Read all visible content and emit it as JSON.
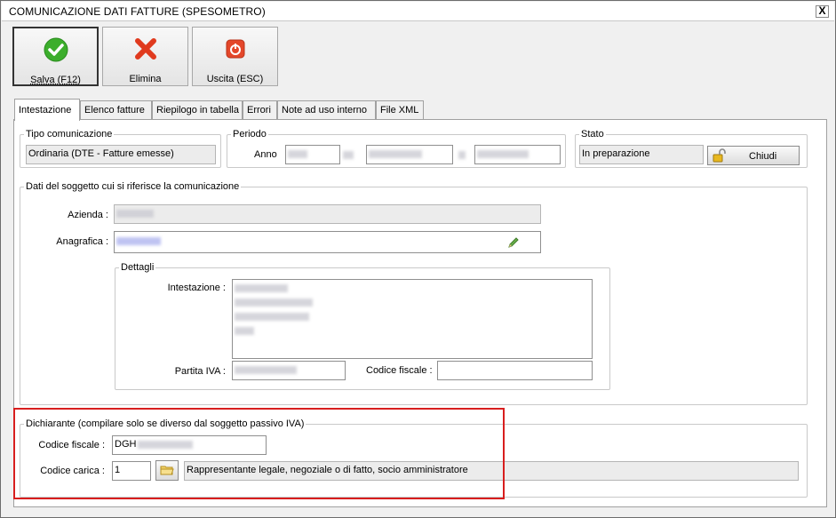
{
  "window": {
    "title": "COMUNICAZIONE DATI FATTURE (SPESOMETRO)",
    "close_label": "X"
  },
  "toolbar": {
    "save_label": "Salva (F12)",
    "delete_label": "Elimina",
    "exit_label": "Uscita (ESC)"
  },
  "tabs": [
    {
      "label": "Intestazione"
    },
    {
      "label": "Elenco fatture"
    },
    {
      "label": "Riepilogo in tabella"
    },
    {
      "label": "Errori"
    },
    {
      "label": "Note ad uso interno"
    },
    {
      "label": "File XML"
    }
  ],
  "tipo": {
    "legend": "Tipo comunicazione",
    "value": "Ordinaria (DTE - Fatture emesse)"
  },
  "periodo": {
    "legend": "Periodo",
    "anno_label": "Anno"
  },
  "stato": {
    "legend": "Stato",
    "value": "In preparazione",
    "chiudi_label": "Chiudi"
  },
  "soggetto": {
    "legend": "Dati del soggetto cui si riferisce la comunicazione",
    "azienda_label": "Azienda :",
    "anagrafica_label": "Anagrafica :"
  },
  "dettagli": {
    "legend": "Dettagli",
    "intestazione_label": "Intestazione :",
    "piva_label": "Partita IVA :",
    "cf_label": "Codice fiscale :"
  },
  "dichiarante": {
    "legend": "Dichiarante (compilare solo se diverso dal soggetto passivo IVA)",
    "cf_label": "Codice fiscale :",
    "cf_value_prefix": "DGH",
    "carica_label": "Codice carica :",
    "carica_value": "1",
    "carica_desc": "Rappresentante legale, negoziale o di fatto, socio amministratore"
  },
  "colors": {
    "highlight": "#d81e1e",
    "save_green": "#3cae2c",
    "delete_red": "#e03a1e",
    "exit_red": "#e4472a"
  }
}
